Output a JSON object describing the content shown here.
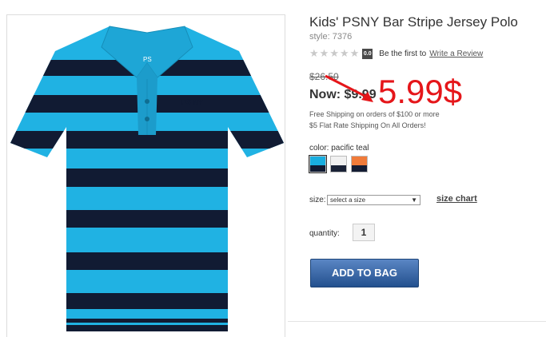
{
  "product": {
    "title": "Kids' PSNY Bar Stripe Jersey Polo",
    "style": "style: 7376",
    "image_icon": "striped-polo-shirt",
    "shirt_logo": "PS",
    "chest_logo": "PS NY"
  },
  "rating": {
    "stars_filled": 0,
    "stars_total": 5,
    "score": "0.0",
    "text": "Be the first to",
    "review_link": "Write a Review"
  },
  "price": {
    "old": "$26.50",
    "now": "Now: $9.99",
    "annotation": "5.99$",
    "annotation_color": "#e5161a"
  },
  "shipping": {
    "line1": "Free Shipping on orders of $100 or more",
    "line2": "$5 Flat Rate Shipping On All Orders!"
  },
  "color": {
    "label": "color: pacific teal",
    "swatches": [
      {
        "name": "pacific teal",
        "top": "#19aee0",
        "bottom": "#111b33"
      },
      {
        "name": "white",
        "top": "#f1f1f1",
        "bottom": "#1a2236"
      },
      {
        "name": "orange",
        "top": "#f07b3a",
        "bottom": "#141c33"
      }
    ]
  },
  "size": {
    "label": "size:",
    "placeholder": "select a size",
    "chart_link": "size chart"
  },
  "quantity": {
    "label": "quantity:",
    "value": "1"
  },
  "cart": {
    "button_label": "ADD TO BAG",
    "button_color": "#2f5d9e"
  }
}
